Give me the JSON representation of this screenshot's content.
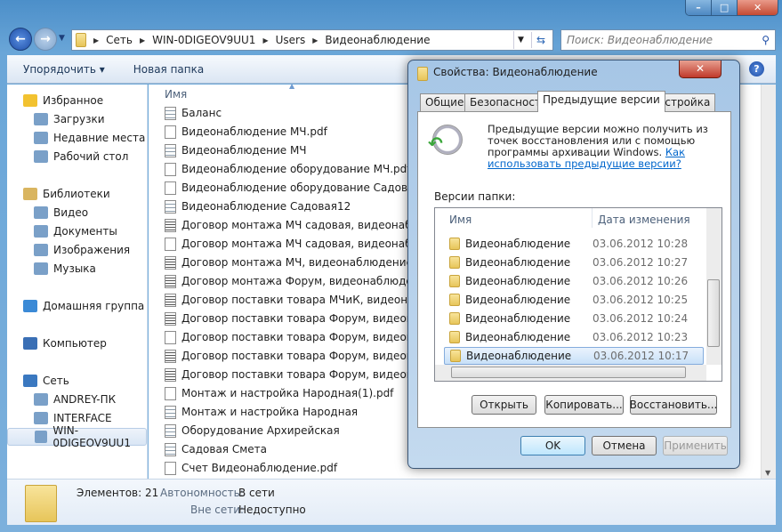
{
  "window": {
    "controls": {
      "minimize": "–",
      "maximize": "□",
      "close": "✕"
    }
  },
  "nav": {
    "back": "←",
    "forward": "→",
    "breadcrumb": [
      "Сеть",
      "WIN-0DIGEOV9UU1",
      "Users",
      "Видеонаблюдение"
    ],
    "search_placeholder": "Поиск: Видеонаблюдение"
  },
  "toolbar": {
    "organize": "Упорядочить ▾",
    "new_folder": "Новая папка",
    "help": "?"
  },
  "sidebar": {
    "items": [
      {
        "label": "Избранное",
        "type": "header"
      },
      {
        "label": "Загрузки"
      },
      {
        "label": "Недавние места"
      },
      {
        "label": "Рабочий стол"
      },
      {
        "label": "Библиотеки",
        "type": "header"
      },
      {
        "label": "Видео"
      },
      {
        "label": "Документы"
      },
      {
        "label": "Изображения"
      },
      {
        "label": "Музыка"
      },
      {
        "label": "Домашняя группа",
        "type": "header"
      },
      {
        "label": "Компьютер",
        "type": "header"
      },
      {
        "label": "Сеть",
        "type": "header"
      },
      {
        "label": "ANDREY-ПК"
      },
      {
        "label": "INTERFACE"
      },
      {
        "label": "WIN-0DIGEOV9UU1",
        "selected": true
      }
    ]
  },
  "files": {
    "column_name": "Имя",
    "rows": [
      {
        "name": "Баланс",
        "icon": "spreadsheet"
      },
      {
        "name": "Видеонаблюдение МЧ.pdf",
        "icon": "pdf"
      },
      {
        "name": "Видеонаблюдение МЧ",
        "icon": "spreadsheet"
      },
      {
        "name": "Видеонаблюдение оборудование МЧ.pdf",
        "icon": "pdf"
      },
      {
        "name": "Видеонаблюдение оборудование Садовая+Ко",
        "icon": "pdf"
      },
      {
        "name": "Видеонаблюдение Садовая12",
        "icon": "spreadsheet"
      },
      {
        "name": "Договор монтажа МЧ садовая, видеонаблюде",
        "icon": "document"
      },
      {
        "name": "Договор монтажа МЧ садовая, видеонаблюде",
        "icon": "pdf"
      },
      {
        "name": "Договор монтажа МЧ, видеонаблюдение",
        "icon": "document"
      },
      {
        "name": "Договор монтажа Форум, видеонаблюдение",
        "icon": "document"
      },
      {
        "name": "Договор поставки товара МЧиК, видеонаблю",
        "icon": "document"
      },
      {
        "name": "Договор поставки товара Форум, видеонабл",
        "icon": "document"
      },
      {
        "name": "Договор поставки товара Форум, видеонабл",
        "icon": "pdf"
      },
      {
        "name": "Договор поставки товара Форум, видеонабл",
        "icon": "document"
      },
      {
        "name": "Договор поставки товара Форум, видеонабл",
        "icon": "document"
      },
      {
        "name": "Монтаж и настройка Народная(1).pdf",
        "icon": "pdf"
      },
      {
        "name": "Монтаж и настройка Народная",
        "icon": "spreadsheet"
      },
      {
        "name": "Оборудование Архирейская",
        "icon": "spreadsheet"
      },
      {
        "name": "Садовая Смета",
        "icon": "spreadsheet"
      },
      {
        "name": "Счет Видеонаблюдение.pdf",
        "icon": "pdf"
      }
    ]
  },
  "status": {
    "items_label": "Элементов: 21",
    "offline_label": "Автономность:",
    "offline_value": "В сети",
    "offline2_label": "Вне сети:",
    "offline2_value": "Недоступно"
  },
  "dialog": {
    "title": "Свойства: Видеонаблюдение",
    "close": "✕",
    "tabs": [
      "Общие",
      "Безопасность",
      "Предыдущие версии",
      "Настройка"
    ],
    "active_tab": 2,
    "description": "Предыдущие версии можно получить из точек восстановления или с помощью программы архивации Windows. ",
    "link": "Как использовать предыдущие версии?",
    "versions_label": "Версии папки:",
    "columns": {
      "name": "Имя",
      "date": "Дата изменения"
    },
    "versions": [
      {
        "name": "Видеонаблюдение",
        "date": "03.06.2012 10:28"
      },
      {
        "name": "Видеонаблюдение",
        "date": "03.06.2012 10:27"
      },
      {
        "name": "Видеонаблюдение",
        "date": "03.06.2012 10:26"
      },
      {
        "name": "Видеонаблюдение",
        "date": "03.06.2012 10:25"
      },
      {
        "name": "Видеонаблюдение",
        "date": "03.06.2012 10:24"
      },
      {
        "name": "Видеонаблюдение",
        "date": "03.06.2012 10:23"
      },
      {
        "name": "Видеонаблюдение",
        "date": "03.06.2012 10:17",
        "selected": true
      }
    ],
    "buttons": {
      "open": "Открыть",
      "copy": "Копировать...",
      "restore": "Восстановить...",
      "ok": "OK",
      "cancel": "Отмена",
      "apply": "Применить"
    }
  }
}
